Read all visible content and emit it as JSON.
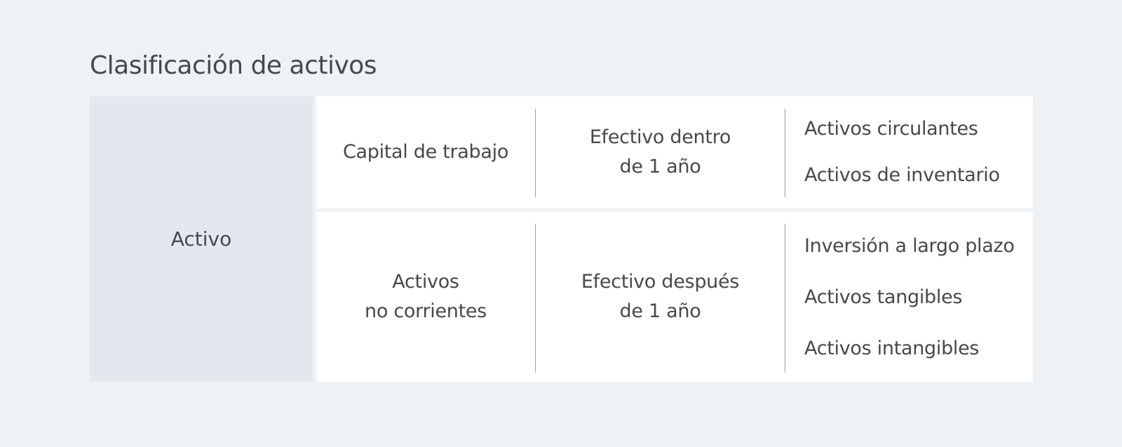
{
  "title": "Clasificación de activos",
  "root": {
    "label": "Activo"
  },
  "rows": [
    {
      "class_lines": [
        "Capital de trabajo"
      ],
      "term_lines": [
        "Efectivo dentro",
        "de 1 año"
      ],
      "items": [
        "Activos circulantes",
        "Activos de inventario"
      ]
    },
    {
      "class_lines": [
        "Activos",
        "no corrientes"
      ],
      "term_lines": [
        "Efectivo después",
        "de 1 año"
      ],
      "items": [
        "Inversión a largo plazo",
        "Activos tangibles",
        "Activos intangibles"
      ]
    }
  ],
  "colors": {
    "background": "#eef2f5",
    "root_fill": "#e3e8ef",
    "cell_fill": "#ffffff",
    "divider": "#9a9da1",
    "text": "#45484d"
  }
}
